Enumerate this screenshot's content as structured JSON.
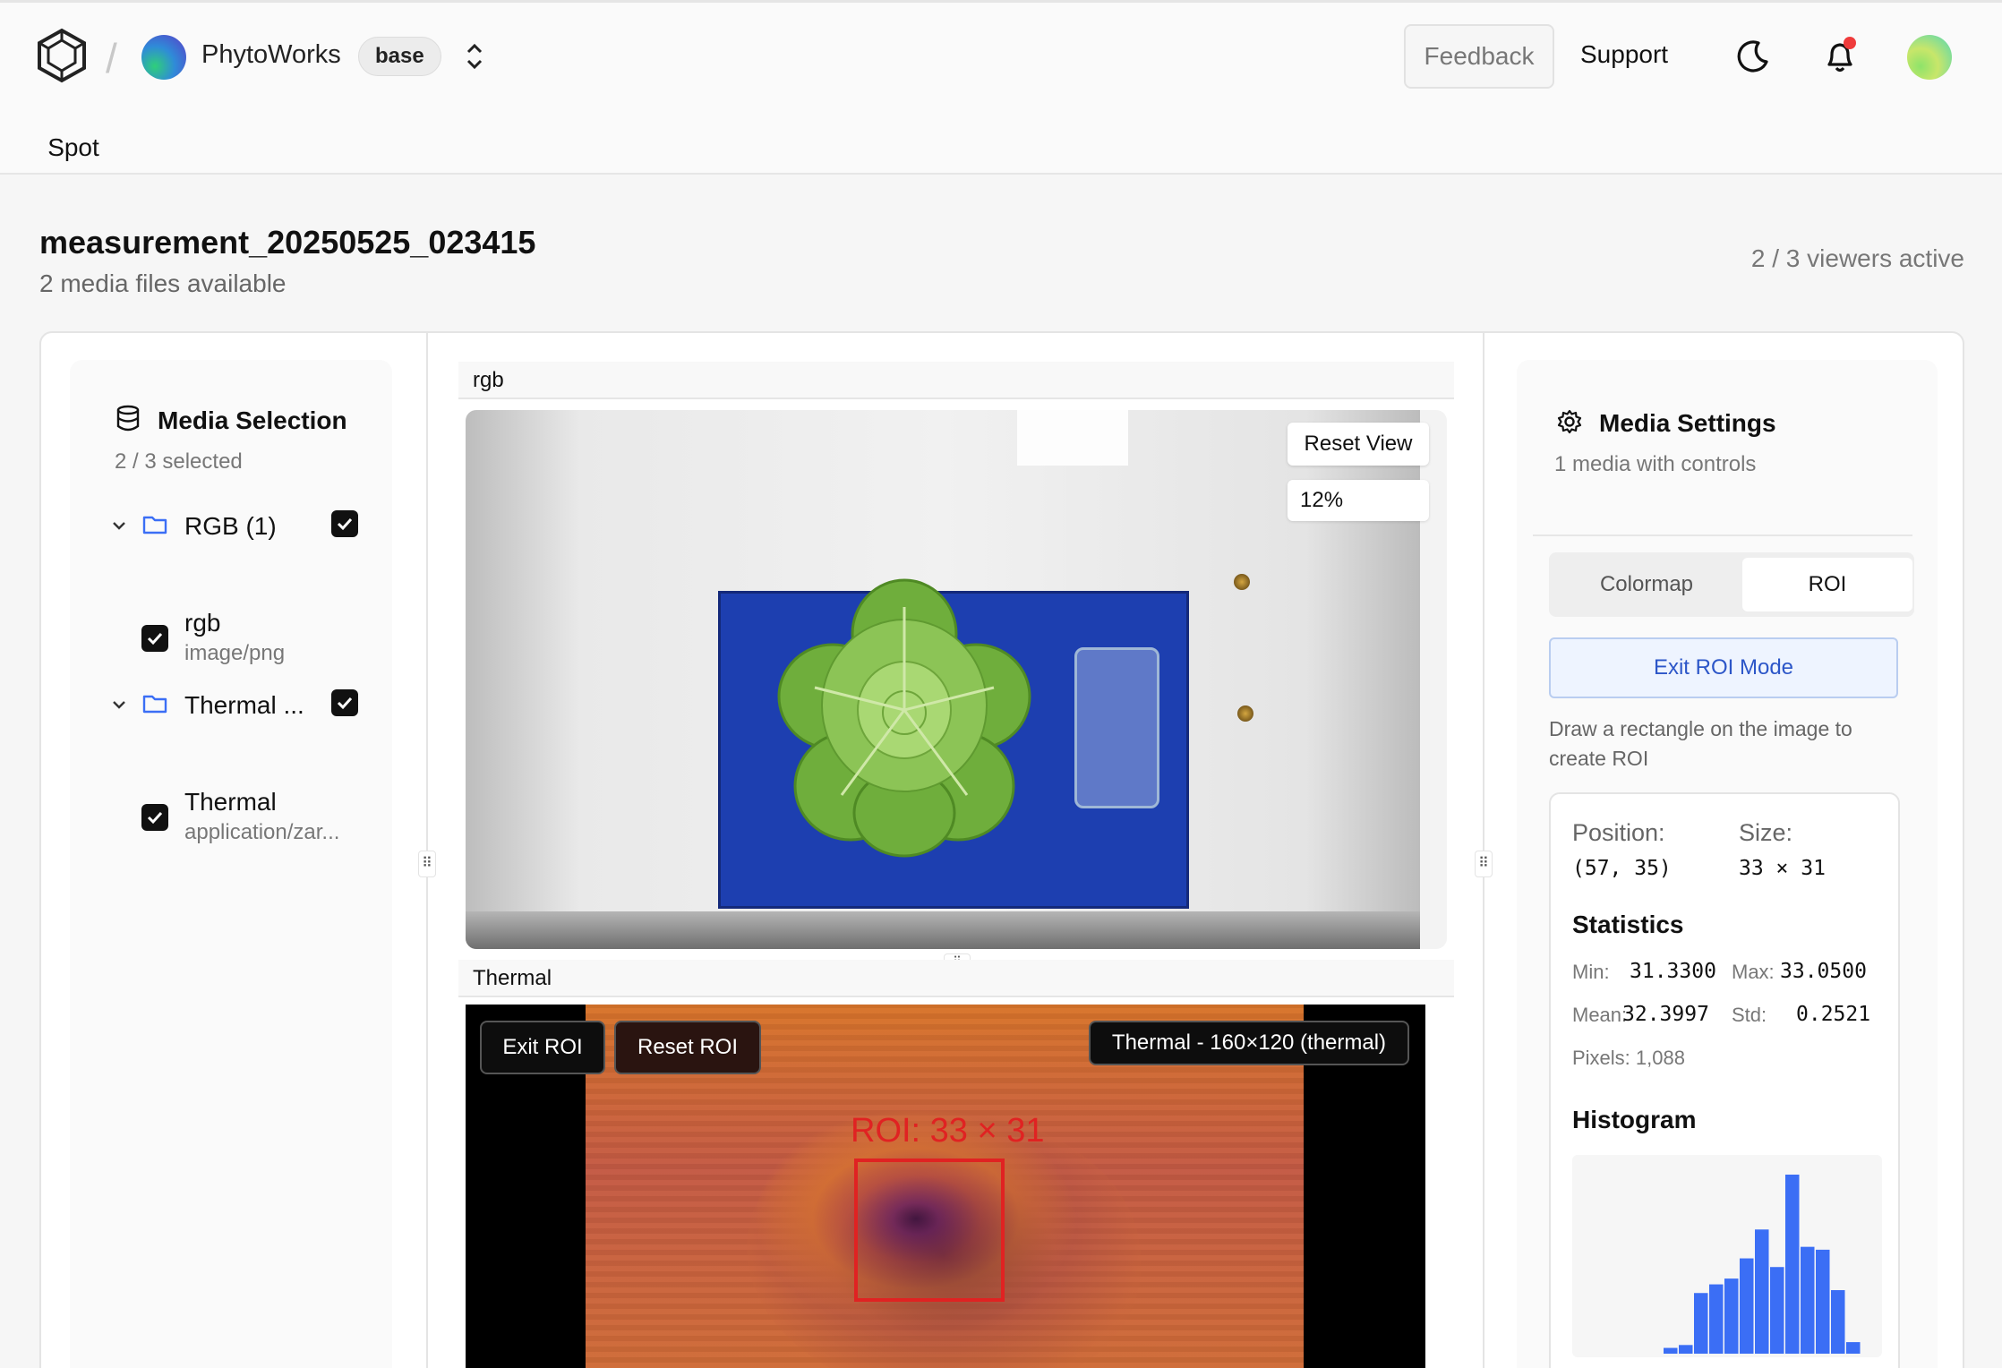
{
  "header": {
    "org_name": "PhytoWorks",
    "environment": "base",
    "feedback_label": "Feedback",
    "support_label": "Support"
  },
  "tabs": [
    {
      "label": "Spot",
      "active": true
    }
  ],
  "page": {
    "title": "measurement_20250525_023415",
    "subtitle": "2 media files available",
    "viewers_active": "2 / 3 viewers active"
  },
  "media_selection": {
    "title": "Media Selection",
    "selected": "2 / 3 selected",
    "groups": [
      {
        "label": "RGB (1)",
        "checked": true,
        "items": [
          {
            "name": "rgb",
            "mime": "image/png",
            "checked": true
          }
        ]
      },
      {
        "label": "Thermal ...",
        "checked": true,
        "items": [
          {
            "name": "Thermal",
            "mime": "application/zar...",
            "checked": true
          }
        ]
      }
    ]
  },
  "viewers": {
    "rgb": {
      "title": "rgb",
      "reset_view_label": "Reset View",
      "zoom": "12%"
    },
    "thermal": {
      "title": "Thermal",
      "exit_roi_label": "Exit ROI",
      "reset_roi_label": "Reset ROI",
      "info_tag": "Thermal - 160×120 (thermal)",
      "roi_label": "ROI: 33 × 31"
    }
  },
  "media_settings": {
    "title": "Media Settings",
    "subtitle": "1 media with controls",
    "tabs": [
      "Colormap",
      "ROI"
    ],
    "active_tab": "ROI",
    "exit_roi_mode_label": "Exit ROI Mode",
    "hint": "Draw a rectangle on the image to create ROI",
    "position_label": "Position:",
    "position_value": "(57, 35)",
    "size_label": "Size:",
    "size_value": "33 × 31",
    "statistics_title": "Statistics",
    "stats": {
      "min_label": "Min:",
      "min": "31.3300",
      "max_label": "Max:",
      "max": "33.0500",
      "mean_label": "Mean:",
      "mean": "32.3997",
      "std_label": "Std:",
      "std": "0.2521",
      "pixels": "Pixels: 1,088"
    },
    "histogram_title": "Histogram",
    "histogram_bins": [
      2,
      3,
      21,
      24,
      26,
      33,
      43,
      30,
      62,
      37,
      36,
      22,
      4
    ],
    "histogram_color": "#3b6ef5"
  },
  "colors": {
    "accent": "#2c56c8",
    "roi": "#e02222",
    "mat": "#1d3fb0"
  },
  "icons": [
    "logo-icon",
    "chevron-updown-icon",
    "moon-icon",
    "bell-icon",
    "database-icon",
    "chevron-down-icon",
    "folder-icon",
    "checkbox-icon",
    "gear-icon",
    "drag-grip-icon"
  ]
}
